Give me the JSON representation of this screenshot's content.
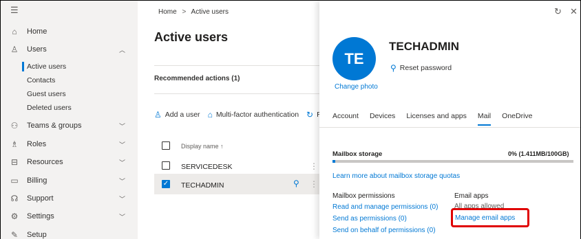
{
  "sidebar": {
    "items": [
      {
        "label": "Home",
        "icon": "home-icon",
        "glyph": "⌂"
      },
      {
        "label": "Users",
        "icon": "user-icon",
        "glyph": "♙",
        "chevron": "︿"
      },
      {
        "label": "Teams & groups",
        "icon": "teams-icon",
        "glyph": "⚇",
        "chevron": "﹀"
      },
      {
        "label": "Roles",
        "icon": "roles-icon",
        "glyph": "♗",
        "chevron": "﹀"
      },
      {
        "label": "Resources",
        "icon": "resources-icon",
        "glyph": "⊟",
        "chevron": "﹀"
      },
      {
        "label": "Billing",
        "icon": "billing-icon",
        "glyph": "▭",
        "chevron": "﹀"
      },
      {
        "label": "Support",
        "icon": "support-icon",
        "glyph": "☊",
        "chevron": "﹀"
      },
      {
        "label": "Settings",
        "icon": "settings-icon",
        "glyph": "⚙",
        "chevron": "﹀"
      },
      {
        "label": "Setup",
        "icon": "setup-icon",
        "glyph": "✎"
      }
    ],
    "sub_items": [
      "Active users",
      "Contacts",
      "Guest users",
      "Deleted users"
    ]
  },
  "main": {
    "breadcrumb": {
      "home": "Home",
      "sep": ">",
      "current": "Active users"
    },
    "title": "Active users",
    "recommended": "Recommended actions (1)",
    "toolbar": {
      "add_user": "Add a user",
      "mfa": "Multi-factor authentication",
      "refresh": "Re"
    },
    "column_header": "Display name ↑",
    "rows": [
      {
        "name": "SERVICEDESK",
        "selected": false
      },
      {
        "name": "TECHADMIN",
        "selected": true
      }
    ]
  },
  "panel": {
    "initials": "TE",
    "name": "TECHADMIN",
    "change_photo": "Change photo",
    "reset_password": "Reset password",
    "tabs": [
      "Account",
      "Devices",
      "Licenses and apps",
      "Mail",
      "OneDrive"
    ],
    "active_tab": "Mail",
    "mailbox_storage": {
      "label": "Mailbox storage",
      "value": "0% (1.411MB/100GB)",
      "fill_fraction": 0.01
    },
    "learn_more": "Learn more about mailbox storage quotas",
    "mailbox_permissions": {
      "title": "Mailbox permissions",
      "links": [
        "Read and manage permissions (0)",
        "Send as permissions (0)",
        "Send on behalf of permissions (0)"
      ]
    },
    "email_apps": {
      "title": "Email apps",
      "status": "All apps allowed",
      "manage": "Manage email apps"
    }
  },
  "colors": {
    "accent": "#0078d4",
    "highlight": "#e00000",
    "sidebar": "#f3f2f1"
  }
}
